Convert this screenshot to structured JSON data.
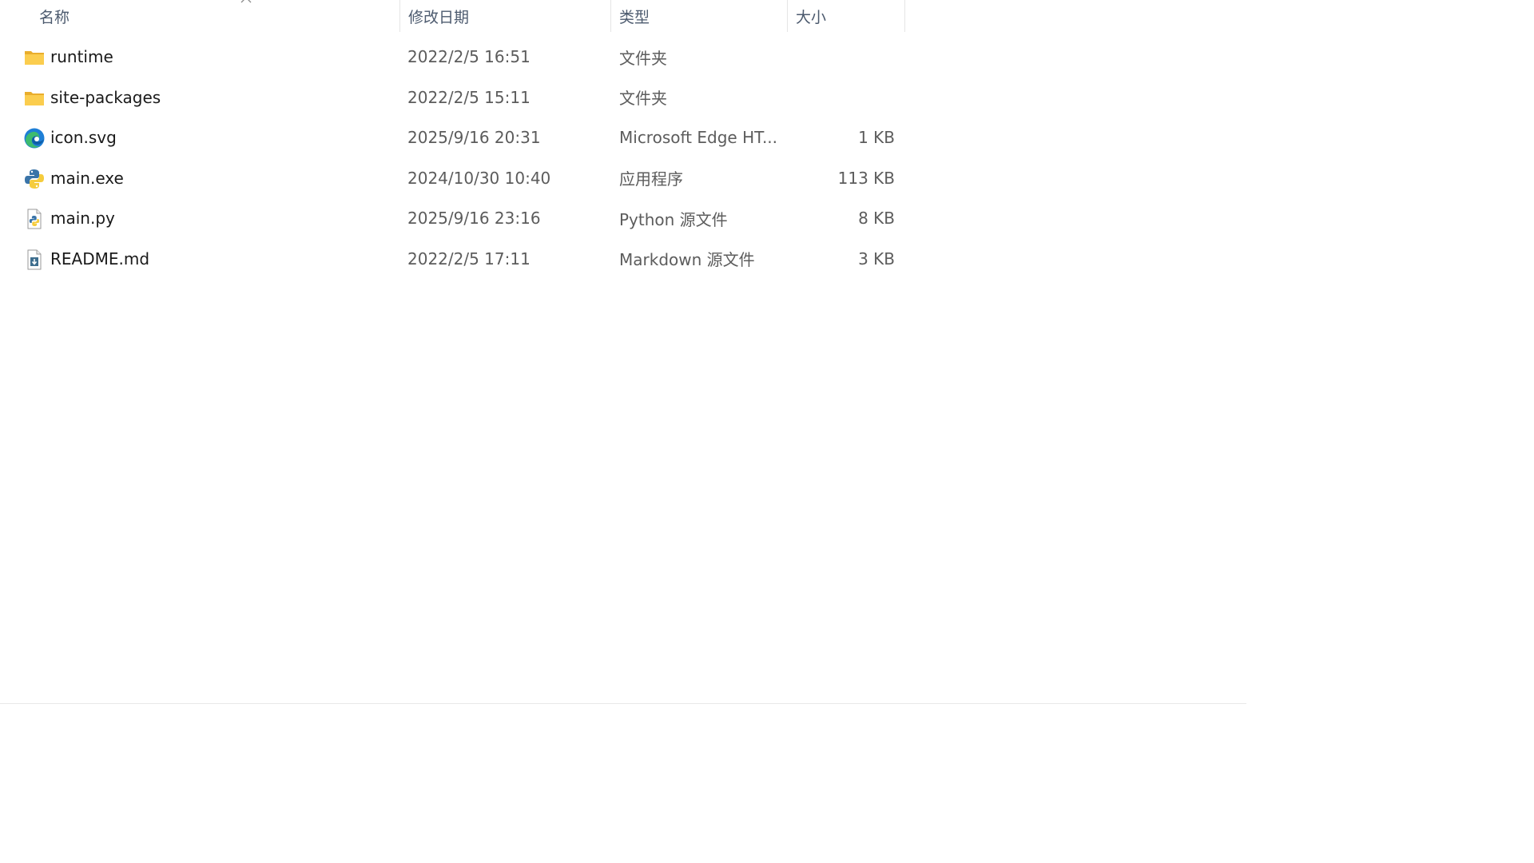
{
  "columns": {
    "name": "名称",
    "date": "修改日期",
    "type": "类型",
    "size": "大小"
  },
  "files": [
    {
      "name": "runtime",
      "date": "2022/2/5 16:51",
      "type": "文件夹",
      "size": "",
      "icon": "folder-icon"
    },
    {
      "name": "site-packages",
      "date": "2022/2/5 15:11",
      "type": "文件夹",
      "size": "",
      "icon": "folder-icon"
    },
    {
      "name": "icon.svg",
      "date": "2025/9/16 20:31",
      "type": "Microsoft Edge HT...",
      "size": "1 KB",
      "icon": "edge-icon"
    },
    {
      "name": "main.exe",
      "date": "2024/10/30 10:40",
      "type": "应用程序",
      "size": "113 KB",
      "icon": "python-app-icon"
    },
    {
      "name": "main.py",
      "date": "2025/9/16 23:16",
      "type": "Python 源文件",
      "size": "8 KB",
      "icon": "python-file-icon"
    },
    {
      "name": "README.md",
      "date": "2022/2/5 17:11",
      "type": "Markdown 源文件",
      "size": "3 KB",
      "icon": "markdown-file-icon"
    }
  ],
  "colors": {
    "folder": "#f8c846",
    "edge_blue": "#1e7fd6",
    "edge_green": "#3dbb6f",
    "python_blue": "#3a74a8",
    "python_yellow": "#f5cc3d"
  }
}
